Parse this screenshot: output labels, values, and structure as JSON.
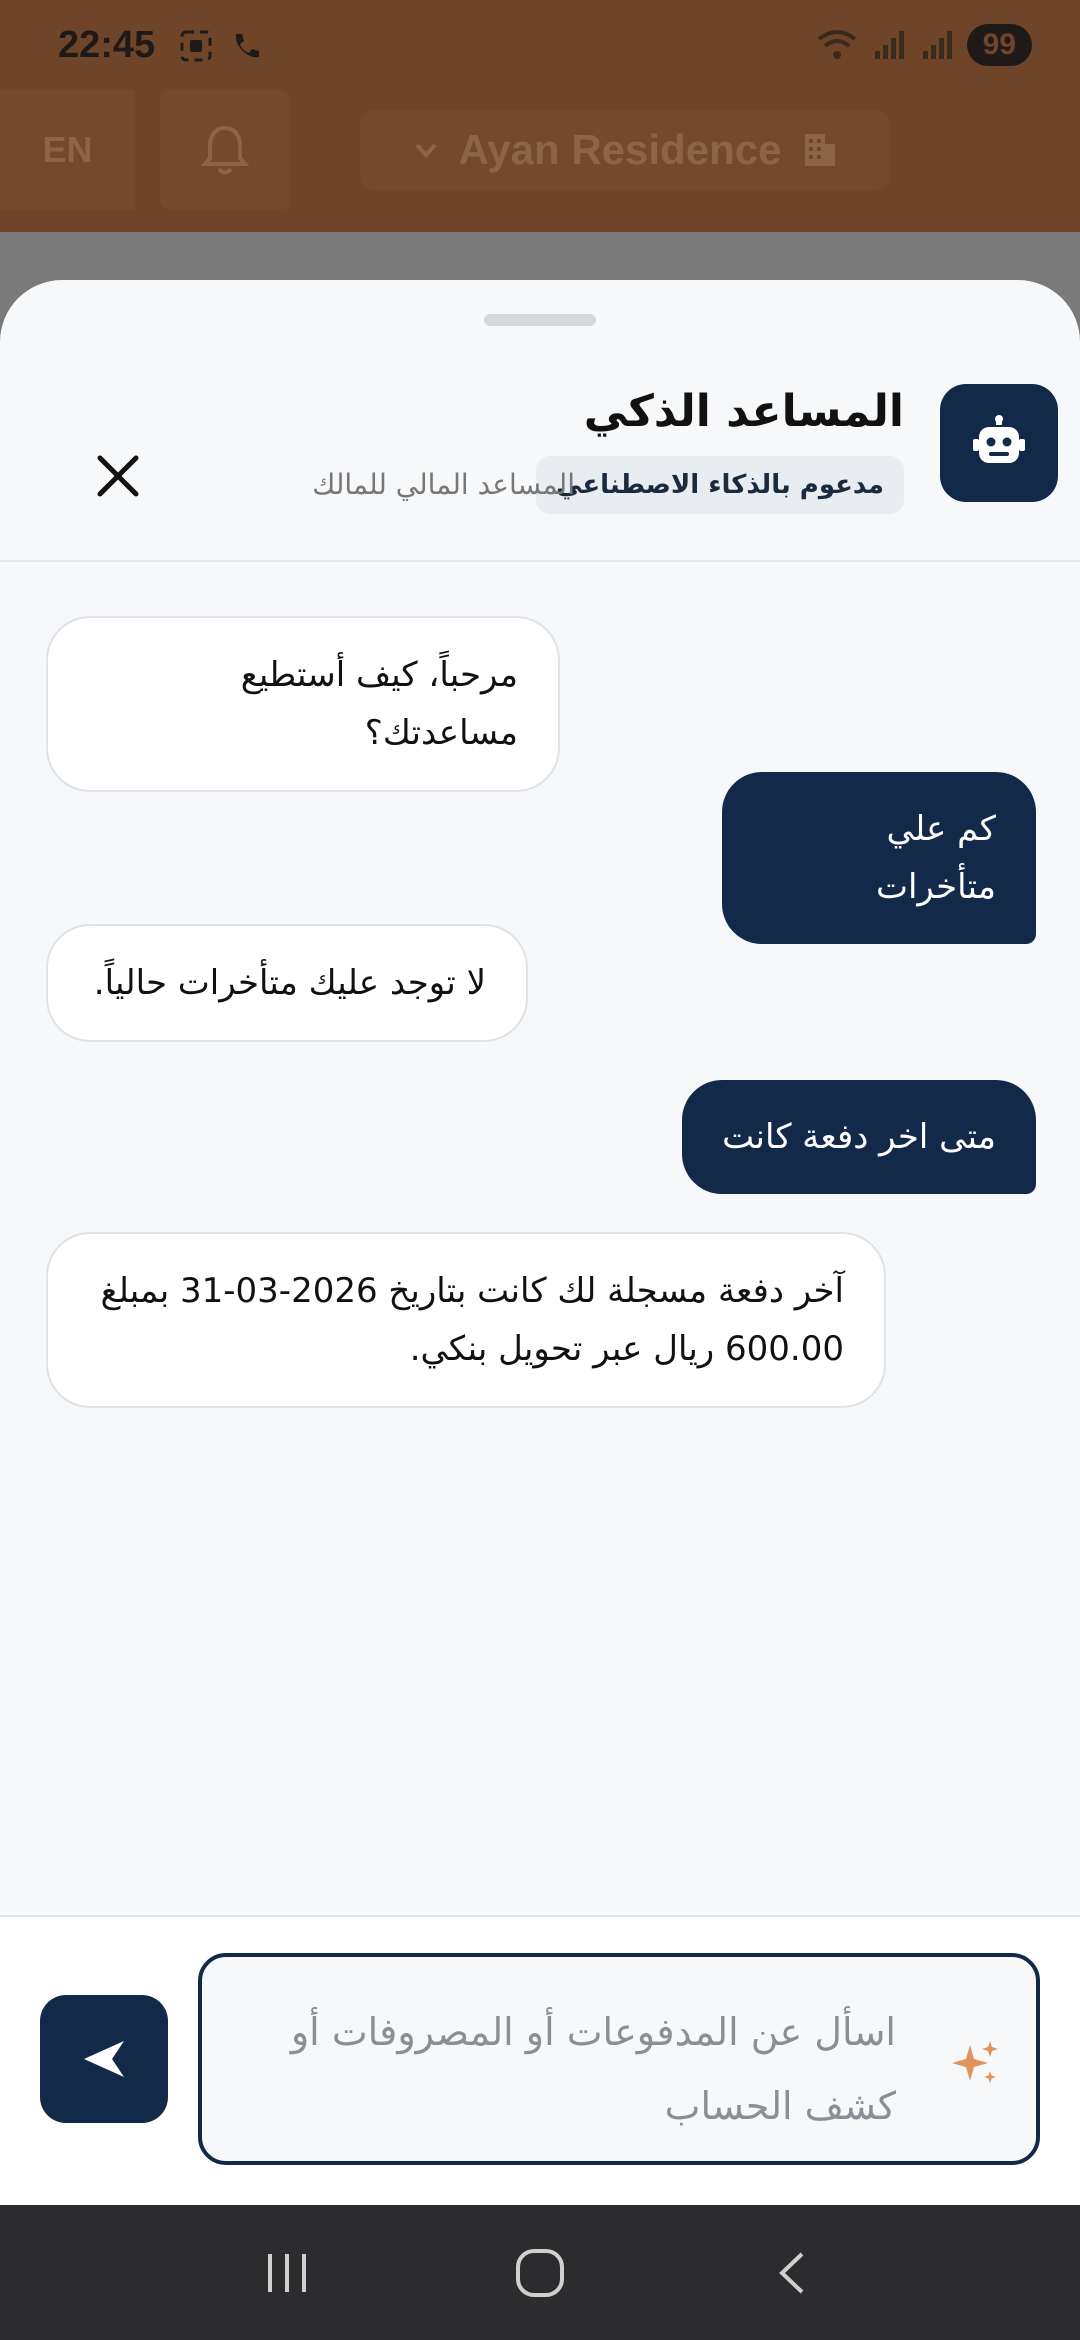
{
  "status_bar": {
    "time": "22:45",
    "battery": "99"
  },
  "header": {
    "language_button": "EN",
    "property_name": "Ayan Residence"
  },
  "chat": {
    "title": "المساعد الذكي",
    "badge": "مدعوم بالذكاء الاصطناعي",
    "subtitle": "المساعد المالي للمالك",
    "messages": [
      {
        "sender": "bot",
        "text": "مرحباً، كيف أستطيع مساعدتك؟"
      },
      {
        "sender": "user",
        "text": "كم علي متأخرات"
      },
      {
        "sender": "bot",
        "text": "لا توجد عليك متأخرات حالياً."
      },
      {
        "sender": "user",
        "text": "متى اخر دفعة كانت"
      },
      {
        "sender": "bot",
        "text": "آخر دفعة مسجلة لك كانت بتاريخ 2026-03-31 بمبلغ 600.00 ريال عبر تحويل بنكي."
      }
    ]
  },
  "composer": {
    "placeholder": "اسأل عن المدفوعات أو المصروفات أو كشف الحساب"
  },
  "colors": {
    "primary": "#12294a",
    "accent": "#e0935a",
    "header_brown": "#6e4529"
  },
  "icons": {
    "bot": "robot-icon",
    "close": "close-icon",
    "send": "send-icon",
    "sparkle": "sparkle-icon",
    "bell": "bell-icon",
    "building": "building-icon"
  }
}
